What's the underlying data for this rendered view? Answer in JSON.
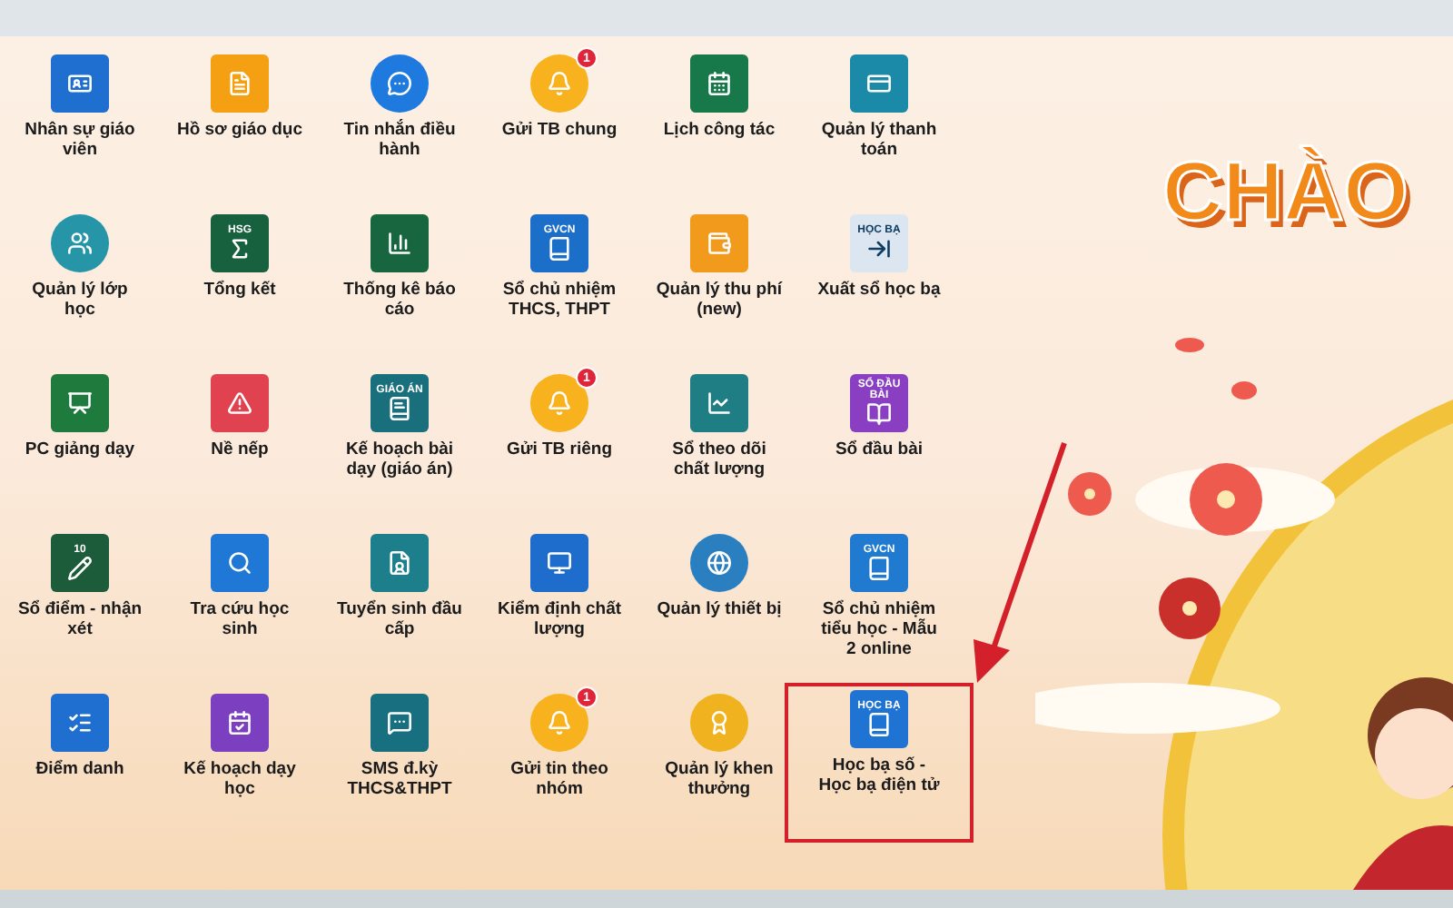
{
  "apps": [
    {
      "label": "Nhân sự giáo viên"
    },
    {
      "label": "Hồ sơ giáo dục"
    },
    {
      "label": "Tin nhắn điều hành"
    },
    {
      "label": "Gửi TB chung",
      "badge": "1"
    },
    {
      "label": "Lịch công tác"
    },
    {
      "label": "Quản lý thanh toán"
    },
    {
      "label": "Quản lý lớp học"
    },
    {
      "label": "Tổng kết",
      "icon_text": "HSG"
    },
    {
      "label": "Thống kê báo cáo"
    },
    {
      "label": "Sổ chủ nhiệm THCS, THPT",
      "icon_text": "GVCN"
    },
    {
      "label": "Quản lý thu phí (new)"
    },
    {
      "label": "Xuất sổ học bạ",
      "icon_text": "HỌC BẠ"
    },
    {
      "label": "PC giảng dạy"
    },
    {
      "label": "Nề nếp"
    },
    {
      "label": "Kế hoạch bài dạy (giáo án)",
      "icon_text": "GIÁO ÁN"
    },
    {
      "label": "Gửi TB riêng",
      "badge": "1"
    },
    {
      "label": "Sổ theo dõi chất lượng"
    },
    {
      "label": "Sổ đầu bài",
      "icon_text": "SỔ ĐẦU BÀI"
    },
    {
      "label": "Sổ điểm - nhận xét",
      "icon_text": "10"
    },
    {
      "label": "Tra cứu học sinh"
    },
    {
      "label": "Tuyển sinh đầu cấp"
    },
    {
      "label": "Kiểm định chất lượng"
    },
    {
      "label": "Quản lý thiết bị"
    },
    {
      "label": "Sổ chủ nhiệm tiểu học - Mẫu 2 online",
      "icon_text": "GVCN"
    },
    {
      "label": "Điểm danh"
    },
    {
      "label": "Kế hoạch dạy học"
    },
    {
      "label": "SMS đ.kỳ THCS&THPT"
    },
    {
      "label": "Gửi tin theo nhóm",
      "badge": "1"
    },
    {
      "label": "Quản lý khen thưởng"
    },
    {
      "label": "Học bạ số - Học bạ điện tử",
      "icon_text": "HỌC BẠ",
      "highlighted": true
    }
  ],
  "banner": {
    "title": "CHÀO"
  }
}
